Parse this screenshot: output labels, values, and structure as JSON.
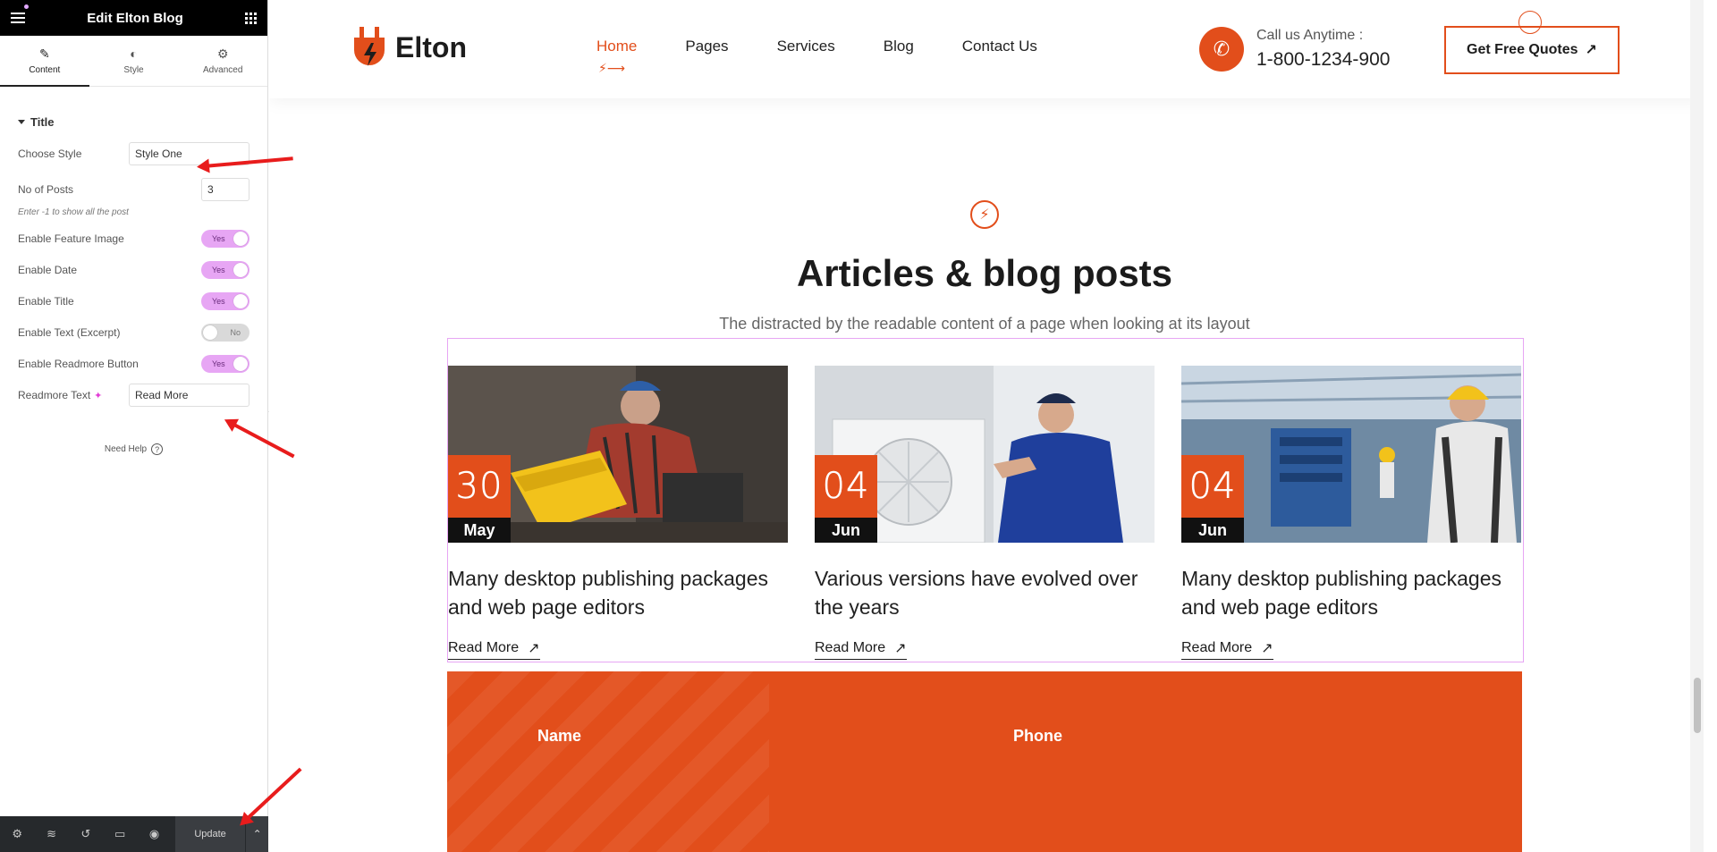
{
  "panel": {
    "title": "Edit Elton Blog",
    "tabs": [
      {
        "label": "Content",
        "icon": "pencil-icon"
      },
      {
        "label": "Style",
        "icon": "half-circle-icon"
      },
      {
        "label": "Advanced",
        "icon": "gear-icon"
      }
    ],
    "section_title": "Title",
    "choose_style_label": "Choose Style",
    "choose_style_value": "Style One",
    "posts_label": "No of Posts",
    "posts_value": "3",
    "posts_hint": "Enter -1 to show all the post",
    "toggles": [
      {
        "label": "Enable Feature Image",
        "state": "Yes",
        "on": true
      },
      {
        "label": "Enable Date",
        "state": "Yes",
        "on": true
      },
      {
        "label": "Enable Title",
        "state": "Yes",
        "on": true
      },
      {
        "label": "Enable Text (Excerpt)",
        "state": "No",
        "on": false
      },
      {
        "label": "Enable Readmore Button",
        "state": "Yes",
        "on": true
      }
    ],
    "readmore_label": "Readmore Text",
    "readmore_value": "Read More",
    "need_help": "Need Help",
    "footer": {
      "update": "Update"
    }
  },
  "site": {
    "logo": "Elton",
    "nav": [
      "Home",
      "Pages",
      "Services",
      "Blog",
      "Contact Us"
    ],
    "call_label": "Call us Anytime :",
    "call_number": "1-800-1234-900",
    "quote_button": "Get Free Quotes",
    "section_title": "Articles & blog posts",
    "section_subtitle": "The distracted by the readable content of a page when looking at its layout",
    "posts": [
      {
        "day": "30",
        "month": "May",
        "title": "Many desktop publishing packages and web page editors",
        "read_more": "Read More"
      },
      {
        "day": "04",
        "month": "Jun",
        "title": "Various versions have evolved over the years",
        "read_more": "Read More"
      },
      {
        "day": "04",
        "month": "Jun",
        "title": "Many desktop publishing packages and web page editors",
        "read_more": "Read More"
      }
    ],
    "form_labels": [
      "Name",
      "Phone"
    ]
  },
  "colors": {
    "accent": "#e24e1b",
    "toggle_on": "#e7a6f4",
    "annotation": "#e81c1c"
  }
}
